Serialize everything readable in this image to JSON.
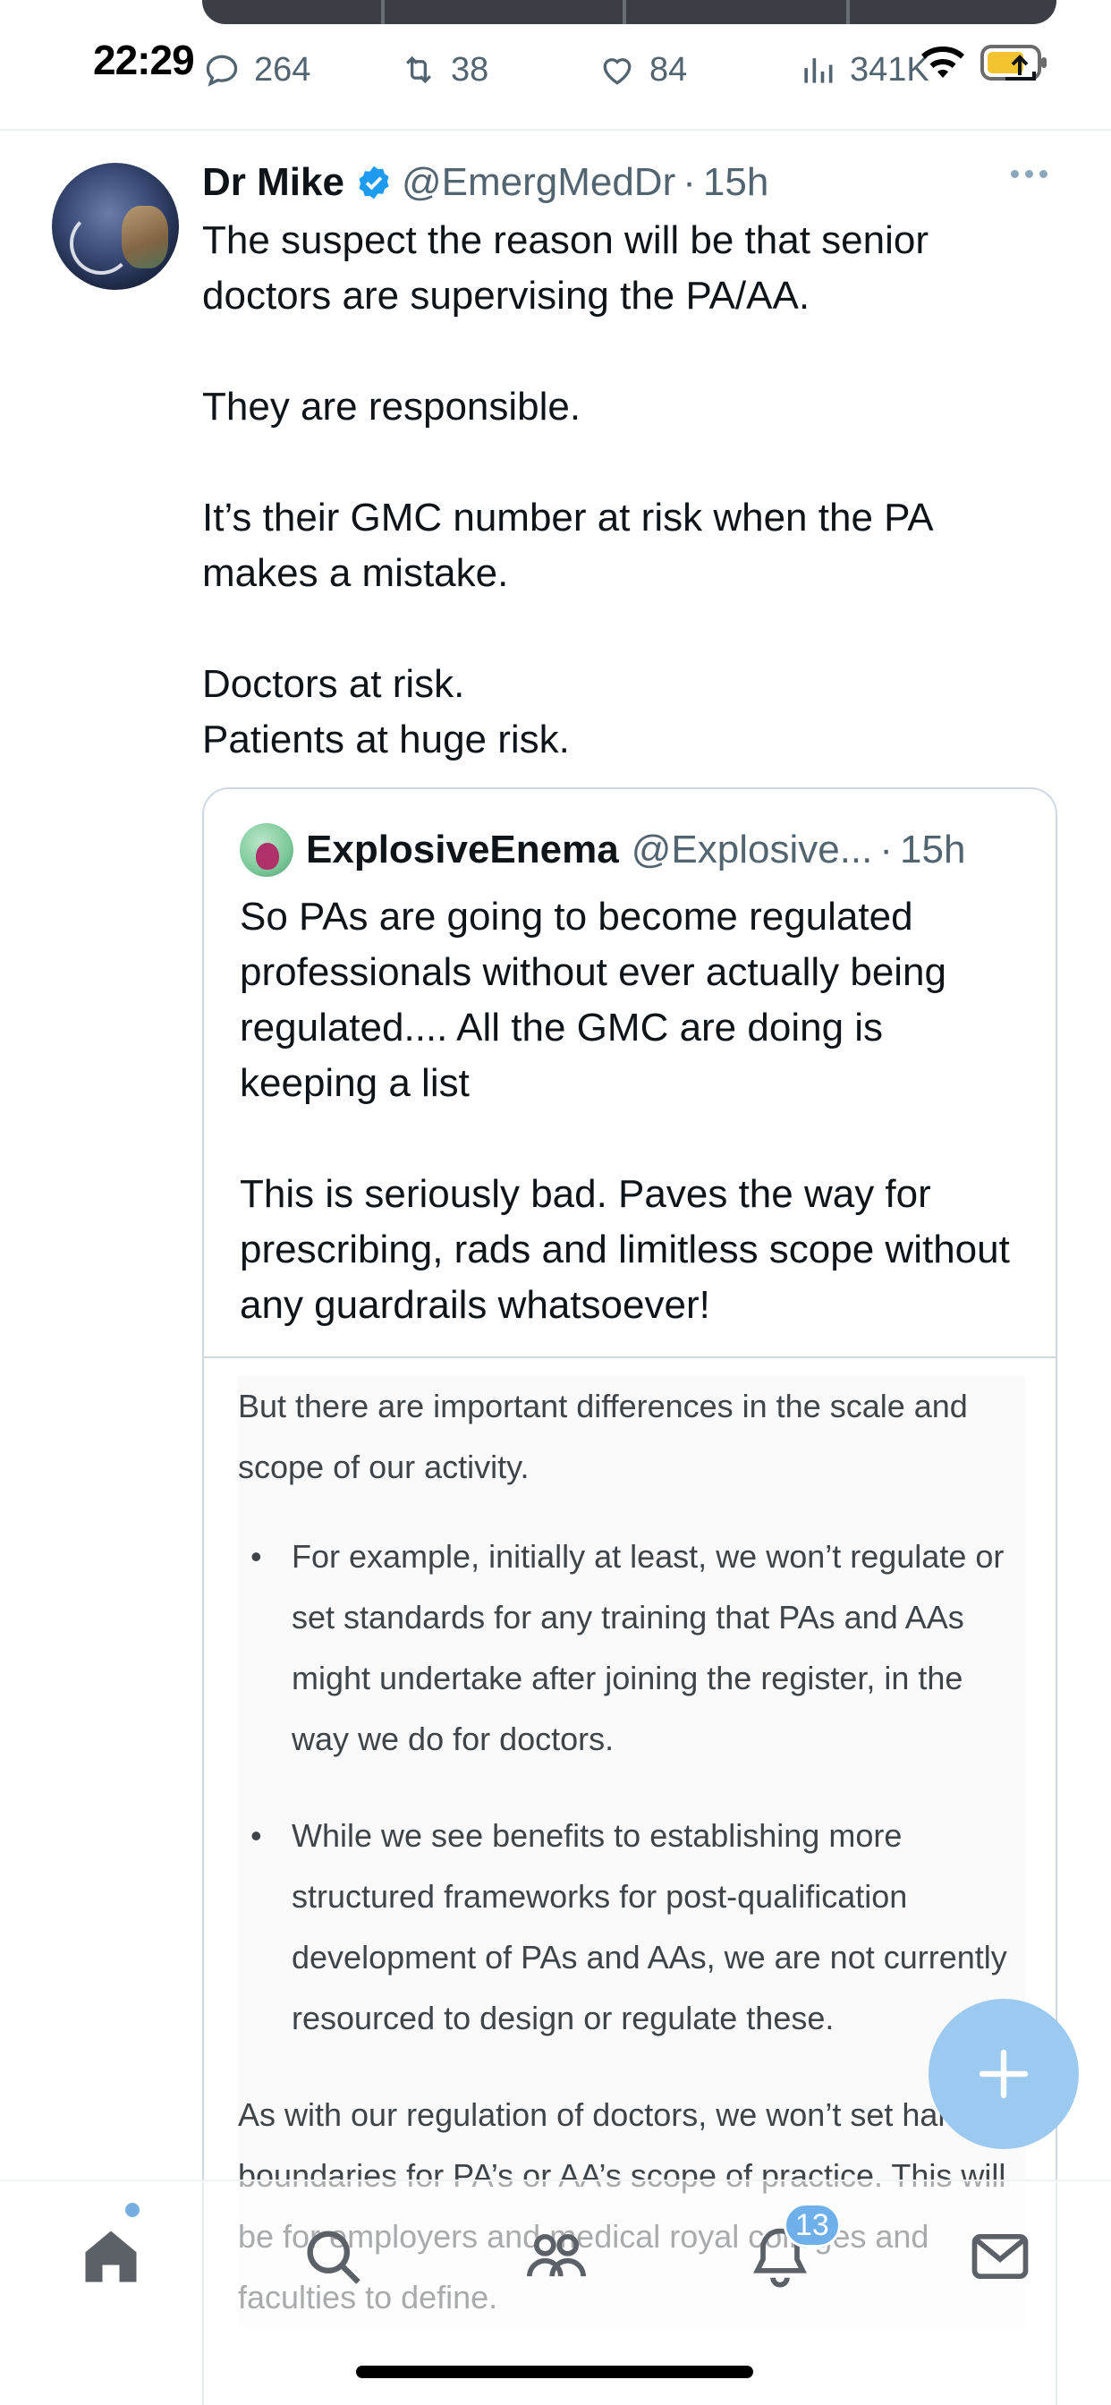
{
  "status_bar": {
    "time": "22:29"
  },
  "previous_tweet_actions": {
    "replies": "264",
    "retweets": "38",
    "likes": "84",
    "views": "341K"
  },
  "tweet": {
    "author_name": "Dr Mike",
    "handle": "@EmergMedDr",
    "separator": "·",
    "time": "15h",
    "lines": [
      "The suspect the reason will be that senior doctors are supervising the PA/AA.",
      "They are responsible.",
      "It’s their GMC number at risk when the PA makes a mistake.",
      "Doctors at risk.",
      "Patients at huge risk."
    ]
  },
  "quote": {
    "author_name": "ExplosiveEnema",
    "handle": "@Explosive...",
    "separator": "·",
    "time": "15h",
    "paragraph_1": "So PAs are going to become regulated professionals without ever actually being regulated.... All the GMC are doing is keeping a list",
    "paragraph_2": "This is seriously bad. Paves the way for prescribing, rads and limitless scope without any guardrails whatsoever!",
    "document": {
      "intro": "But there are important differences in the scale and scope of our activity.",
      "bullets": [
        "For example, initially at least, we won’t regulate or set standards for any training that PAs and AAs might undertake after joining the register, in the way we do for doctors.",
        "While we see benefits to establishing more structured frameworks for post-qualification development of PAs and AAs, we are not currently resourced to design or regulate these."
      ],
      "closing": "As with our regulation of doctors, we won’t set hard boundaries for PA’s or AA’s scope of practice. This will be for employers and medical royal colleges and faculties to define."
    }
  },
  "bottom_nav": {
    "notifications_badge": "13",
    "items": [
      "home-icon",
      "search-icon",
      "communities-icon",
      "notifications-icon",
      "messages-icon"
    ]
  },
  "colors": {
    "accent": "#1d9bf0",
    "fab": "#9bc9ef",
    "secondary_text": "#536471"
  }
}
